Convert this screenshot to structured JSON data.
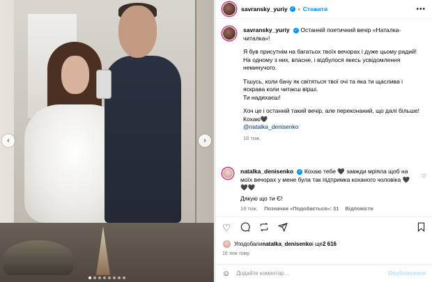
{
  "author": {
    "username": "savransky_yuriy",
    "follow_label": "Стежити",
    "more_icon": "more-horizontal-icon"
  },
  "caption": {
    "first_line": "Останній поетичний вечір «Наталка-читалка»!",
    "paragraphs": [
      "Я був присутнім на багатьох твоїх вечорах і дуже цьому радий! На одному з них, власне, і відбулося якесь усвідомлення неминучого.",
      "Тішусь, коли бачу як світяться твої очі та яка ти щаслива і яскрава коли читаєш вірші.\nТи надихаєш!",
      "Хоч це і останній такий вечір, але переконаний, що далі більше!\nКохаю🖤"
    ],
    "mention": "@natalka_denisenko",
    "age": "16 тиж."
  },
  "comment": {
    "username": "natalka_denisenko",
    "text": "Кохаю тебе 🖤 завжди мріяла щоб на моїх вечорах у мене була так підтримка коханого чоловіка 🖤 🖤🖤",
    "text2": "Дякую що ти Є!",
    "age": "16 тиж.",
    "likes_label": "Позначки «Подобається»: 31",
    "reply_label": "Відповісти"
  },
  "likes": {
    "prefix": "Уподобали ",
    "user": "natalka_denisenko",
    "middle": " і ще ",
    "count": "2 616"
  },
  "timestamp": "16 тиж тому",
  "comment_input": {
    "placeholder": "Додайте коментар...",
    "post_label": "Опублікувати"
  },
  "carousel": {
    "slides": 8,
    "active": 0
  },
  "colors": {
    "accent": "#0095f6",
    "mention": "#00376b",
    "muted": "#737373"
  }
}
